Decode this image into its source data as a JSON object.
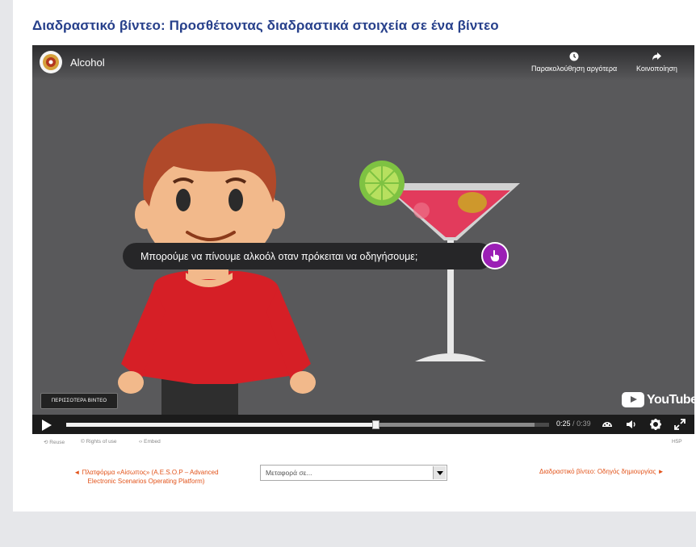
{
  "page": {
    "title": "Διαδραστικό βίντεο: Προσθέτοντας διαδραστικά στοιχεία σε ένα βίντεο"
  },
  "player": {
    "video_title": "Alcohol",
    "watch_later_label": "Παρακολούθηση αργότερα",
    "share_label": "Κοινοποίηση",
    "question_text": "Μπορούμε να πίνουμε αλκοόλ οταν πρόκειται να οδηγήσουμε;",
    "more_videos_label": "ΠΕΡΙΣΣΟΤΕΡΑ ΒΙΝΤΕΟ",
    "brand": "YouTube",
    "time_current": "0:25",
    "time_separator": "/",
    "time_total": "0:39",
    "progress_fraction": 0.641,
    "buffer_fraction": 0.97
  },
  "below_player": {
    "reuse_label": "Reuse",
    "rights_label": "Rights of use",
    "embed_label": "Embed",
    "h5p_label": "H5P"
  },
  "navigation": {
    "prev_label": "◄ Πλατφόρμα «Αίσωπος» (A.E.S.O.P – Advanced Electronic Scenarios Operating Platform)",
    "jump_placeholder": "Μεταφορά σε...",
    "next_label": "Διαδραστικό βίντεο: Οδηγός δημιουργίας ►"
  },
  "colors": {
    "title": "#27408b",
    "link": "#e2531a",
    "hotspot": "#9b1fb5",
    "video_bg": "#59595b"
  }
}
